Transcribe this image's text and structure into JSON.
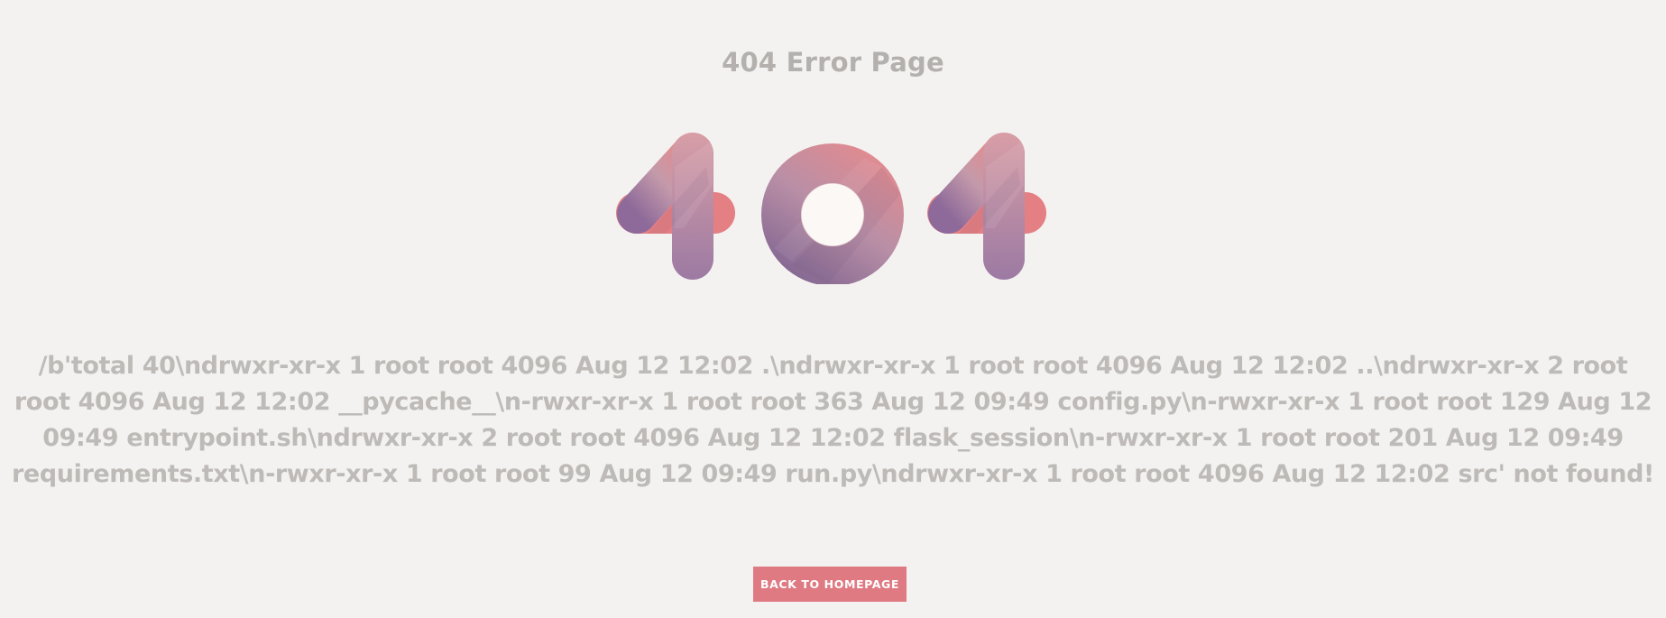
{
  "page": {
    "title": "404 Error Page",
    "graphic_label": "404",
    "message": "/b'total 40\\ndrwxr-xr-x 1 root root 4096 Aug 12 12:02 .\\ndrwxr-xr-x 1 root root 4096 Aug 12 12:02 ..\\ndrwxr-xr-x 2 root root 4096 Aug 12 12:02 __pycache__\\n-rwxr-xr-x 1 root root 363 Aug 12 09:49 config.py\\n-rwxr-xr-x 1 root root 129 Aug 12 09:49 entrypoint.sh\\ndrwxr-xr-x 2 root root 4096 Aug 12 12:02 flask_session\\n-rwxr-xr-x 1 root root 201 Aug 12 09:49 requirements.txt\\n-rwxr-xr-x 1 root root 99 Aug 12 09:49 run.py\\ndrwxr-xr-x 1 root root 4096 Aug 12 12:02 src' not found!",
    "button_label": "BACK TO HOMEPAGE"
  },
  "colors": {
    "background": "#f4f2f0",
    "text_muted": "#bdbab8",
    "accent": "#df7a83",
    "gradient_pink": "#e88a8a",
    "gradient_purple": "#8e6a9a",
    "gradient_mauve": "#c49aaa",
    "inner_circle": "#fcf8f5"
  },
  "icons": {
    "graphic": "404-illustration"
  }
}
